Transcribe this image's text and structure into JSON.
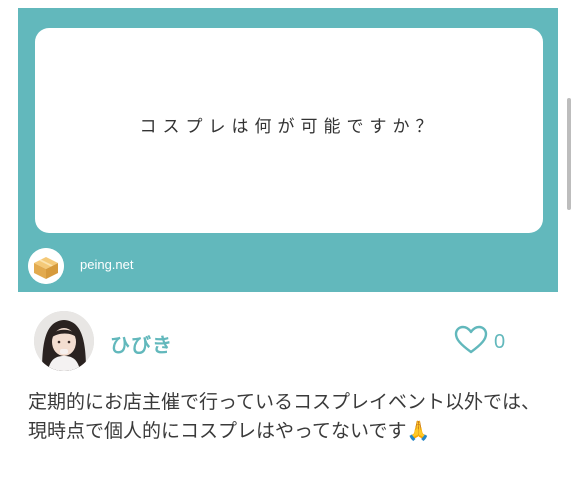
{
  "question": {
    "text": "コスプレは何が可能ですか？"
  },
  "brand": {
    "name": "peing.net",
    "icon": "box-icon"
  },
  "answer": {
    "username": "ひびき",
    "likes": "0",
    "body": "定期的にお店主催で行っているコスプレイベント以外では、現時点で個人的にコスプレはやってないです🙏"
  },
  "colors": {
    "accent": "#62b8bc",
    "card_bg": "#62b8bc",
    "text": "#3a3a3a"
  }
}
